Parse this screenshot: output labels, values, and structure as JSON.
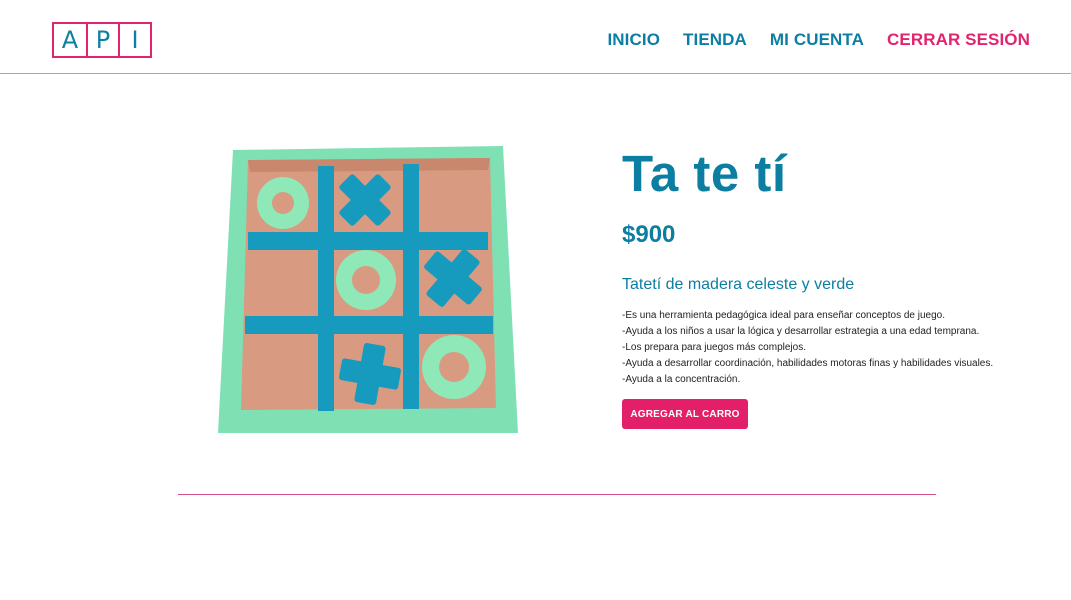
{
  "header": {
    "logo_letters": [
      "A",
      "P",
      "I"
    ],
    "nav": [
      {
        "label": "INICIO"
      },
      {
        "label": "TIENDA"
      },
      {
        "label": "MI CUENTA"
      },
      {
        "label": "CERRAR SESIÓN"
      }
    ]
  },
  "product": {
    "title": "Ta te tí",
    "price": "$900",
    "subtitle": "Tatetí de madera celeste y verde",
    "description": [
      "-Es una herramienta pedagógica ideal para enseñar conceptos de juego.",
      "-Ayuda a los niños a usar la lógica y desarrollar estrategia a una edad temprana.",
      "-Los prepara para juegos más complejos.",
      "-Ayuda a desarrollar coordinación, habilidades motoras finas y habilidades visuales.",
      "-Ayuda a la concentración."
    ],
    "add_to_cart_label": "AGREGAR AL CARRO"
  },
  "colors": {
    "brand_blue": "#0c7ea2",
    "brand_pink": "#e0246e"
  }
}
